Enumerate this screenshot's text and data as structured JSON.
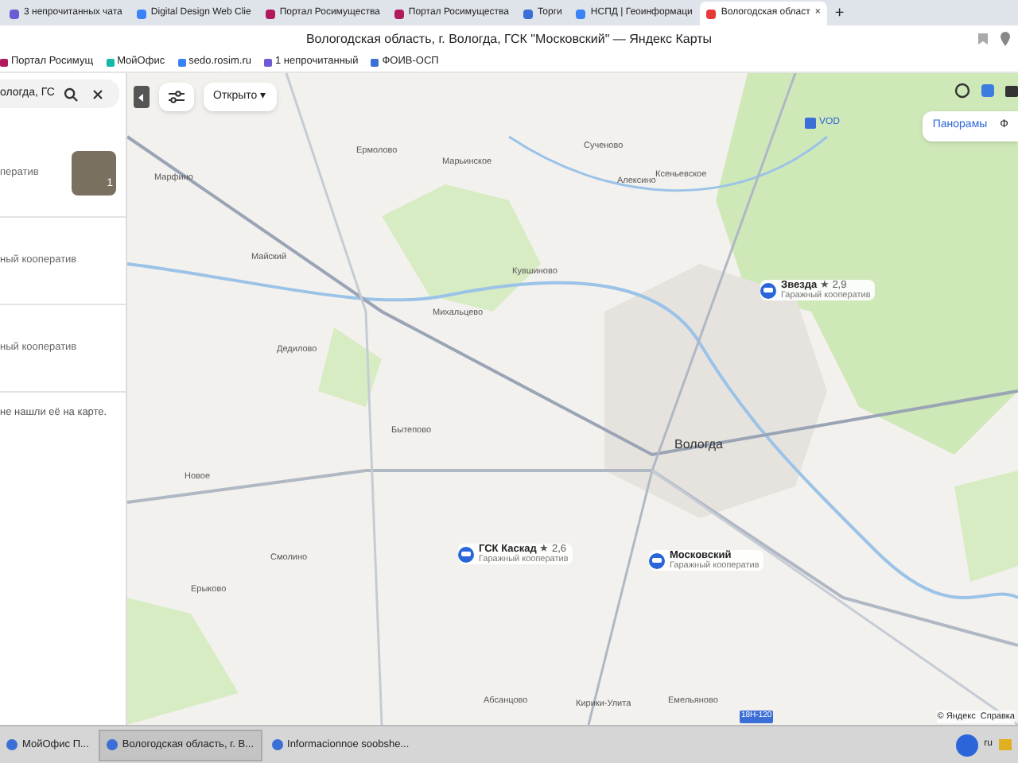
{
  "tabs": [
    {
      "label": "3 непрочитанных чата",
      "selected": false,
      "color": "#6b5bd6"
    },
    {
      "label": "Digital Design Web Clie",
      "selected": false,
      "color": "#3b82f6"
    },
    {
      "label": "Портал Росимущества",
      "selected": false,
      "color": "#b0195e"
    },
    {
      "label": "Портал Росимущества",
      "selected": false,
      "color": "#b0195e"
    },
    {
      "label": "Торги",
      "selected": false,
      "color": "#3b6fd6"
    },
    {
      "label": "НСПД | Геоинформаци",
      "selected": false,
      "color": "#3b82f6"
    },
    {
      "label": "Вологодская област",
      "selected": true,
      "color": "#e53935"
    }
  ],
  "new_tab": "+",
  "close_tab": "×",
  "window": {
    "title": "Вологодская область, г. Вологда, ГСК \"Московский\" — Яндекс Карты"
  },
  "bookmarks": [
    {
      "label": "Портал Росимущ",
      "color": "#b0195e"
    },
    {
      "label": "МойОфис",
      "color": "#14b8a6"
    },
    {
      "label": "sedo.rosim.ru",
      "color": "#3b82f6"
    },
    {
      "label": "1 непрочитанный",
      "color": "#6b5bd6"
    },
    {
      "label": "ФОИВ-ОСП",
      "color": "#3b6fd6"
    }
  ],
  "search": {
    "value": "ологда, ГС"
  },
  "results": [
    {
      "text": "ператив",
      "photo": true,
      "photo_count": "1"
    },
    {
      "text": "ный кооператив",
      "photo": false
    },
    {
      "text": "ный кооператив",
      "photo": false
    }
  ],
  "not_found": "не нашли её на карте.",
  "map_controls": {
    "filter": "Открыто ▾",
    "panoramas": "Панорамы",
    "photos": "Ф"
  },
  "places": [
    "Марфино",
    "Ермолово",
    "Марьинское",
    "Сученово",
    "Ксеньевское",
    "Алексино",
    "Майский",
    "Кувшиново",
    "Михальцево",
    "Дедилово",
    "Бытепово",
    "Новое",
    "Смолино",
    "Ерыково",
    "Абсанцово",
    "Кирики-Улита",
    "Емельяново"
  ],
  "city": "Вологда",
  "vod": "VOD",
  "road_badge": "18Н-120",
  "markers": [
    {
      "name": "Звезда",
      "rating": "★ 2,9",
      "type": "Гаражный кооператив"
    },
    {
      "name": "ГСК Каскад",
      "rating": "★ 2,6",
      "type": "Гаражный кооператив"
    },
    {
      "name": "Московский",
      "type": "Гаражный кооператив"
    }
  ],
  "copyright": "© Яндекс  Справка",
  "taskbar": [
    {
      "label": "МойОфис П...",
      "selected": false
    },
    {
      "label": "Вологодская область, г. В...",
      "selected": true
    },
    {
      "label": "Informacionnoe soobshe...",
      "selected": false
    }
  ],
  "lang": "ru"
}
